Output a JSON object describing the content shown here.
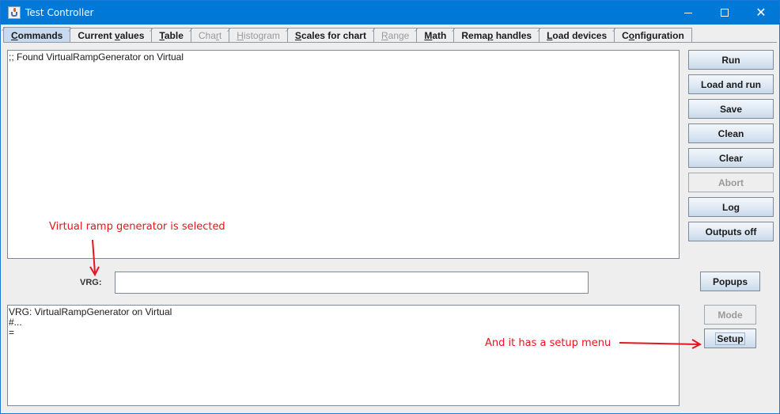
{
  "window": {
    "title": "Test Controller",
    "controls": {
      "minimize": "minimize",
      "maximize": "maximize",
      "close": "close"
    }
  },
  "tabs": [
    {
      "label": "Commands",
      "mnemonic_index": 0,
      "active": true,
      "enabled": true
    },
    {
      "label": "Current values",
      "mnemonic_index": 8,
      "active": false,
      "enabled": true
    },
    {
      "label": "Table",
      "mnemonic_index": 0,
      "active": false,
      "enabled": true
    },
    {
      "label": "Chart",
      "mnemonic_index": 3,
      "active": false,
      "enabled": false
    },
    {
      "label": "Histogram",
      "mnemonic_index": 0,
      "active": false,
      "enabled": false
    },
    {
      "label": "Scales for chart",
      "mnemonic_index": 0,
      "active": false,
      "enabled": true
    },
    {
      "label": "Range",
      "mnemonic_index": 0,
      "active": false,
      "enabled": false
    },
    {
      "label": "Math",
      "mnemonic_index": 0,
      "active": false,
      "enabled": true
    },
    {
      "label": "Remap handles",
      "mnemonic_index": 4,
      "active": false,
      "enabled": true
    },
    {
      "label": "Load devices",
      "mnemonic_index": 0,
      "active": false,
      "enabled": true
    },
    {
      "label": "Configuration",
      "mnemonic_index": 1,
      "active": false,
      "enabled": true
    }
  ],
  "commands": {
    "text": ";; Found VirtualRampGenerator on Virtual"
  },
  "side_buttons": [
    {
      "label": "Run",
      "enabled": true
    },
    {
      "label": "Load and run",
      "enabled": true
    },
    {
      "label": "Save",
      "enabled": true
    },
    {
      "label": "Clean",
      "enabled": true
    },
    {
      "label": "Clear",
      "enabled": true
    },
    {
      "label": "Abort",
      "enabled": false
    },
    {
      "label": "Log",
      "enabled": true
    },
    {
      "label": "Outputs off",
      "enabled": true
    }
  ],
  "device": {
    "label": "VRG:",
    "input_value": "",
    "popups_label": "Popups",
    "mode_label": "Mode",
    "setup_label": "Setup"
  },
  "output": {
    "text": "VRG: VirtualRampGenerator on Virtual\n#...\n="
  },
  "annotations": {
    "selected_note": "Virtual ramp generator is selected",
    "setup_note": "And it has a setup menu",
    "color": "#e8141e"
  }
}
